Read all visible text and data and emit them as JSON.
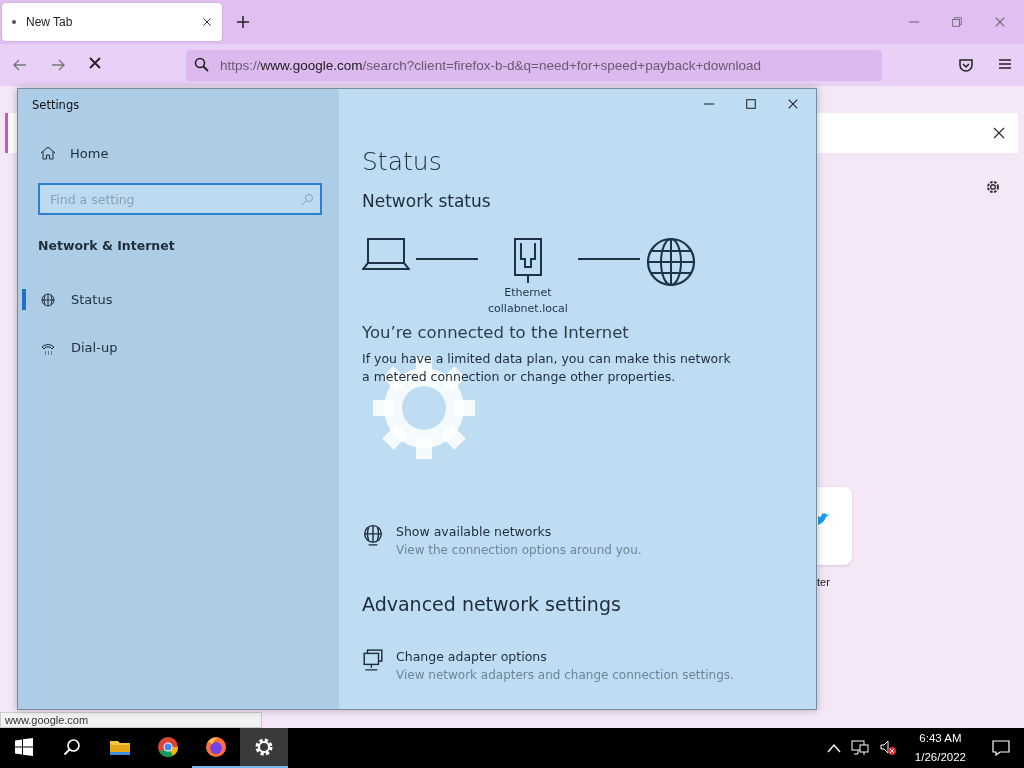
{
  "browser": {
    "tab": {
      "title": "New Tab",
      "selected": true
    },
    "url": {
      "scheme": "https://",
      "host": "www.google.com",
      "path": "/search?client=firefox-b-d&q=need+for+speed+payback+download"
    },
    "shortcut_label_fragment": "ter",
    "status_url": "www.google.com"
  },
  "settings_window": {
    "title": "Settings",
    "sidebar": {
      "home": "Home",
      "search": {
        "placeholder": "Find a setting"
      },
      "section": "Network & Internet",
      "items": [
        {
          "label": "Status",
          "kind": "status",
          "selected": true
        },
        {
          "label": "Dial-up",
          "kind": "dialup",
          "selected": false
        }
      ]
    },
    "main": {
      "heading": "Status",
      "subheading": "Network status",
      "adapter": {
        "name": "Ethernet",
        "network": "collabnet.local"
      },
      "connection_title": "You’re connected to the Internet",
      "connection_text": "If you have a limited data plan, you can make this network a metered connection or change other properties.",
      "links": [
        {
          "kind": "networks",
          "title": "Show available networks",
          "description": "View the connection options around you."
        }
      ],
      "advanced_heading": "Advanced network settings",
      "advanced_links": [
        {
          "kind": "adapter",
          "title": "Change adapter options",
          "description": "View network adapters and change connection settings."
        }
      ]
    }
  },
  "taskbar": {
    "apps": [
      {
        "kind": "files",
        "running": false,
        "selected": false
      },
      {
        "kind": "chrome",
        "running": false,
        "selected": false
      },
      {
        "kind": "firefox",
        "running": true,
        "selected": false
      },
      {
        "kind": "settings",
        "running": true,
        "selected": true
      }
    ],
    "time": "6:43 AM",
    "date": "1/26/2022"
  }
}
